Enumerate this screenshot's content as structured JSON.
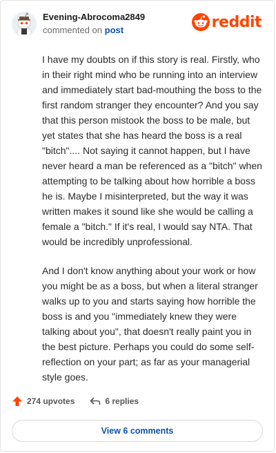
{
  "header": {
    "username": "Evening-Abrocoma2849",
    "meta_prefix": "commented on",
    "meta_link": "post",
    "brand": "reddit"
  },
  "comment": {
    "paragraphs": [
      "I have my doubts on if this story is real. Firstly, who in their right mind who be running into an interview and immediately start bad-mouthing the boss to the first random stranger they encounter? And you say that this person mistook the boss to be male, but yet states that she has heard the boss is a real \"bitch\".... Not saying it cannot happen, but I have never heard a man be referenced as a \"bitch\" when attempting to be talking about how horrible a boss he is. Maybe I misinterpreted, but the way it was written makes it sound like she would be calling a female a \"bitch.\" If it's real, I would say NTA. That would be incredibly unprofessional.",
      "And I don't know anything about your work or how you might be as a boss, but when a literal stranger walks up to you and starts saying how horrible the boss is and you \"immediately knew they were talking about you\", that doesn't really paint you in the best picture. Perhaps you could do some self-reflection on your part; as far as your managerial style goes."
    ]
  },
  "actions": {
    "upvotes": "274 upvotes",
    "replies": "6 replies",
    "view_comments": "View 6 comments"
  },
  "colors": {
    "brand": "#ff4500",
    "link": "#0a53a8"
  }
}
